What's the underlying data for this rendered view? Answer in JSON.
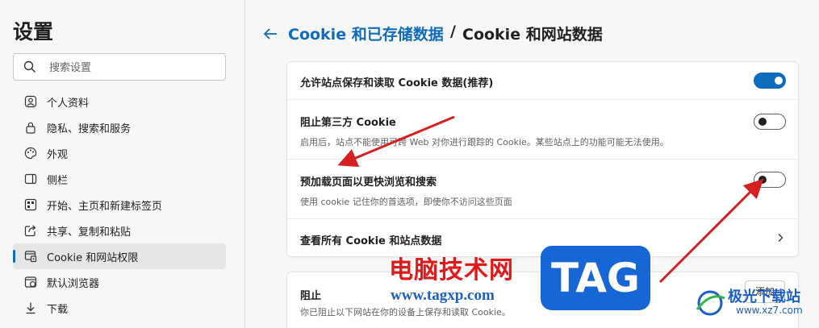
{
  "sidebar": {
    "title": "设置",
    "search_placeholder": "搜索设置",
    "items": [
      {
        "label": "个人资料",
        "icon": "profile-icon"
      },
      {
        "label": "隐私、搜索和服务",
        "icon": "lock-icon"
      },
      {
        "label": "外观",
        "icon": "palette-icon"
      },
      {
        "label": "侧栏",
        "icon": "sidebar-icon"
      },
      {
        "label": "开始、主页和新建标签页",
        "icon": "home-grid-icon"
      },
      {
        "label": "共享、复制和粘贴",
        "icon": "share-icon"
      },
      {
        "label": "Cookie 和网站权限",
        "icon": "site-permissions-icon",
        "active": true
      },
      {
        "label": "默认浏览器",
        "icon": "browser-icon"
      },
      {
        "label": "下载",
        "icon": "download-icon"
      }
    ]
  },
  "header": {
    "breadcrumb_link": "Cookie 和已存储数据",
    "separator": "/",
    "current": "Cookie 和网站数据"
  },
  "settings": [
    {
      "title": "允许站点保存和读取 Cookie 数据(推荐)",
      "description": "",
      "control": "toggle",
      "on": true
    },
    {
      "title": "阻止第三方 Cookie",
      "description": "启用后，站点不能使用可跨 Web 对你进行跟踪的 Cookie。某些站点上的功能可能无法使用。",
      "control": "toggle",
      "on": false
    },
    {
      "title": "预加载页面以更快浏览和搜索",
      "description": "使用 cookie 记住你的首选项，即使你不访问这些页面",
      "control": "toggle",
      "on": false
    },
    {
      "title": "查看所有 Cookie 和站点数据",
      "description": "",
      "control": "chevron"
    }
  ],
  "block_section": {
    "title": "阻止",
    "description": "你已阻止以下网站在你的设备上保存和读取 Cookie。",
    "add_label": "添加"
  },
  "watermark": {
    "cn_text": "电脑技术网",
    "url": "www.tagxp.com",
    "tag": "TAG",
    "site_name": "极光下载站",
    "site_url": "www.xz7.com"
  },
  "colors": {
    "accent": "#0f6cbd",
    "annotation_arrow": "#d42020"
  }
}
